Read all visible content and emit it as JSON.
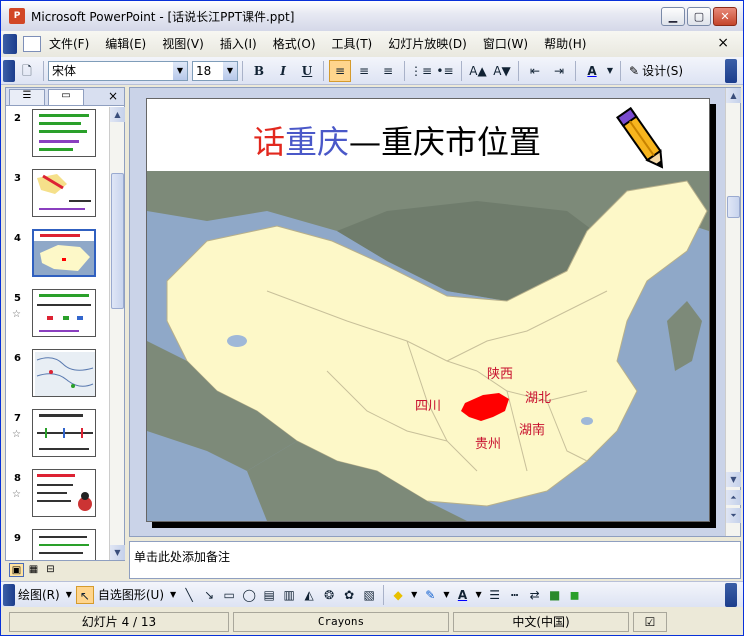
{
  "window": {
    "title": "Microsoft PowerPoint - [话说长江PPT课件.ppt]",
    "app_icon_text": "P"
  },
  "menubar": {
    "items": [
      "文件(F)",
      "编辑(E)",
      "视图(V)",
      "插入(I)",
      "格式(O)",
      "工具(T)",
      "幻灯片放映(D)",
      "窗口(W)",
      "帮助(H)"
    ],
    "close": "×"
  },
  "toolbar": {
    "font_name": "宋体",
    "font_size": "18",
    "design_label": "设计(S)"
  },
  "thumbnails": {
    "slides": [
      {
        "num": "2",
        "star": ""
      },
      {
        "num": "3",
        "star": ""
      },
      {
        "num": "4",
        "star": "",
        "selected": true
      },
      {
        "num": "5",
        "star": "☆"
      },
      {
        "num": "6",
        "star": ""
      },
      {
        "num": "7",
        "star": "☆"
      },
      {
        "num": "8",
        "star": "☆"
      },
      {
        "num": "9",
        "star": ""
      }
    ]
  },
  "slide": {
    "title_part1": "话",
    "title_part2": "重庆",
    "title_part3": "—重庆市位置",
    "labels": {
      "shaanxi": "陕西",
      "sichuan": "四川",
      "hubei": "湖北",
      "hunan": "湖南",
      "guizhou": "贵州"
    },
    "colors": {
      "red": "#e2281e",
      "blue": "#4a58c8",
      "chongqing": "#ff0000",
      "land": "#fdf8c8",
      "sea": "#8fa8c8"
    }
  },
  "notes": {
    "placeholder": "单击此处添加备注"
  },
  "drawbar": {
    "draw_label": "绘图(R)",
    "autoshape_label": "自选图形(U)"
  },
  "status": {
    "slide_info": "幻灯片 4 / 13",
    "template": "Crayons",
    "language": "中文(中国)"
  }
}
